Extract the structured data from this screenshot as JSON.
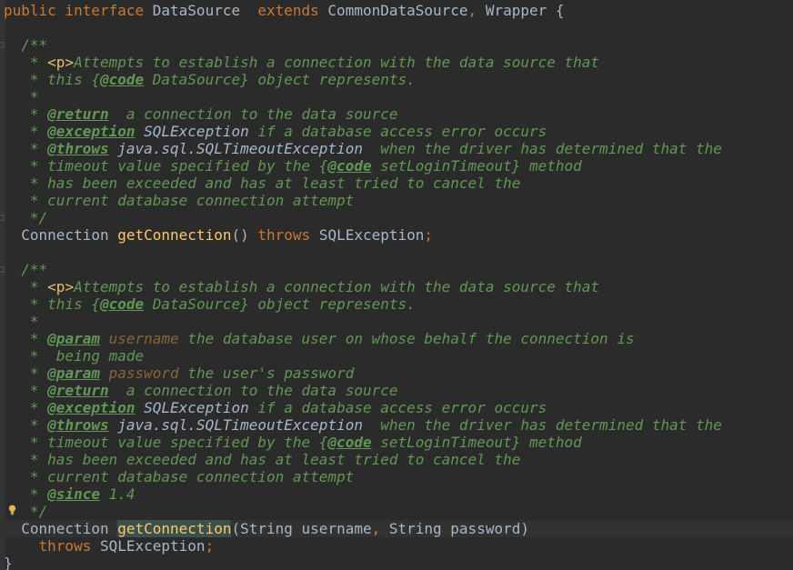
{
  "editor": {
    "language": "java",
    "colors": {
      "background": "#2b2b2b",
      "keyword": "#cc7832",
      "method": "#ffc66d",
      "javadoc": "#629755",
      "javadoc_param": "#8a653b",
      "text": "#a9b7c6",
      "html_tag": "#e8bf6a"
    },
    "lines": [
      [
        [
          "kw",
          "public interface "
        ],
        [
          "cls",
          "DataSource  "
        ],
        [
          "kw",
          "extends "
        ],
        [
          "cls",
          "CommonDataSource"
        ],
        [
          "punct",
          ", "
        ],
        [
          "cls",
          "Wrapper {"
        ]
      ],
      [],
      [
        [
          "doc",
          "  /**"
        ]
      ],
      [
        [
          "doc",
          "   * "
        ],
        [
          "html",
          "<p>"
        ],
        [
          "doc",
          "Attempts to establish a connection with the data source that"
        ]
      ],
      [
        [
          "doc",
          "   * this {"
        ],
        [
          "tag",
          "@code"
        ],
        [
          "doc",
          " DataSource} object represents."
        ]
      ],
      [
        [
          "doc",
          "   *"
        ]
      ],
      [
        [
          "doc",
          "   * "
        ],
        [
          "tag",
          "@return"
        ],
        [
          "doc",
          "  a connection to the data source"
        ]
      ],
      [
        [
          "doc",
          "   * "
        ],
        [
          "tag",
          "@exception"
        ],
        [
          "docval",
          " SQLException"
        ],
        [
          "doc",
          " if a database access error occurs"
        ]
      ],
      [
        [
          "doc",
          "   * "
        ],
        [
          "tag",
          "@throws"
        ],
        [
          "docval",
          " java.sql.SQLTimeoutException"
        ],
        [
          "doc",
          "  when the driver has determined that the"
        ]
      ],
      [
        [
          "doc",
          "   * timeout value specified by the {"
        ],
        [
          "tag",
          "@code"
        ],
        [
          "doc",
          " setLoginTimeout} method"
        ]
      ],
      [
        [
          "doc",
          "   * has been exceeded and has at least tried to cancel the"
        ]
      ],
      [
        [
          "doc",
          "   * current database connection attempt"
        ]
      ],
      [
        [
          "doc",
          "   */"
        ]
      ],
      [
        [
          "plain",
          "  Connection "
        ],
        [
          "fn",
          "getConnection"
        ],
        [
          "plain",
          "() "
        ],
        [
          "kw",
          "throws "
        ],
        [
          "plain",
          "SQLException"
        ],
        [
          "punct",
          ";"
        ]
      ],
      [],
      [
        [
          "doc",
          "  /**"
        ]
      ],
      [
        [
          "doc",
          "   * "
        ],
        [
          "html",
          "<p>"
        ],
        [
          "doc",
          "Attempts to establish a connection with the data source that"
        ]
      ],
      [
        [
          "doc",
          "   * this {"
        ],
        [
          "tag",
          "@code"
        ],
        [
          "doc",
          " DataSource} object represents."
        ]
      ],
      [
        [
          "doc",
          "   *"
        ]
      ],
      [
        [
          "doc",
          "   * "
        ],
        [
          "tag",
          "@param"
        ],
        [
          "docref",
          " username"
        ],
        [
          "doc",
          " the database user on whose behalf the connection is"
        ]
      ],
      [
        [
          "doc",
          "   *  being made"
        ]
      ],
      [
        [
          "doc",
          "   * "
        ],
        [
          "tag",
          "@param"
        ],
        [
          "docref",
          " password"
        ],
        [
          "doc",
          " the user's password"
        ]
      ],
      [
        [
          "doc",
          "   * "
        ],
        [
          "tag",
          "@return"
        ],
        [
          "doc",
          "  a connection to the data source"
        ]
      ],
      [
        [
          "doc",
          "   * "
        ],
        [
          "tag",
          "@exception"
        ],
        [
          "docval",
          " SQLException"
        ],
        [
          "doc",
          " if a database access error occurs"
        ]
      ],
      [
        [
          "doc",
          "   * "
        ],
        [
          "tag",
          "@throws"
        ],
        [
          "docval",
          " java.sql.SQLTimeoutException"
        ],
        [
          "doc",
          "  when the driver has determined that the"
        ]
      ],
      [
        [
          "doc",
          "   * timeout value specified by the {"
        ],
        [
          "tag",
          "@code"
        ],
        [
          "doc",
          " setLoginTimeout} method"
        ]
      ],
      [
        [
          "doc",
          "   * has been exceeded and has at least tried to cancel the"
        ]
      ],
      [
        [
          "doc",
          "   * current database connection attempt"
        ]
      ],
      [
        [
          "doc",
          "   * "
        ],
        [
          "tag",
          "@since"
        ],
        [
          "doc",
          " 1.4"
        ]
      ],
      [
        [
          "doc",
          "   */"
        ]
      ],
      [
        [
          "plain",
          "  Connection "
        ],
        [
          "fn match",
          "getConnection"
        ],
        [
          "plain",
          "(String username"
        ],
        [
          "punct",
          ", "
        ],
        [
          "plain",
          "String password)"
        ]
      ],
      [
        [
          "plain",
          "    "
        ],
        [
          "kw",
          "throws "
        ],
        [
          "plain",
          "SQLException"
        ],
        [
          "punct",
          ";"
        ]
      ],
      [
        [
          "plain",
          "}"
        ]
      ]
    ],
    "current_line": 30,
    "fold_markers": [
      2,
      12,
      15
    ],
    "intention_bulb_line": 29
  }
}
